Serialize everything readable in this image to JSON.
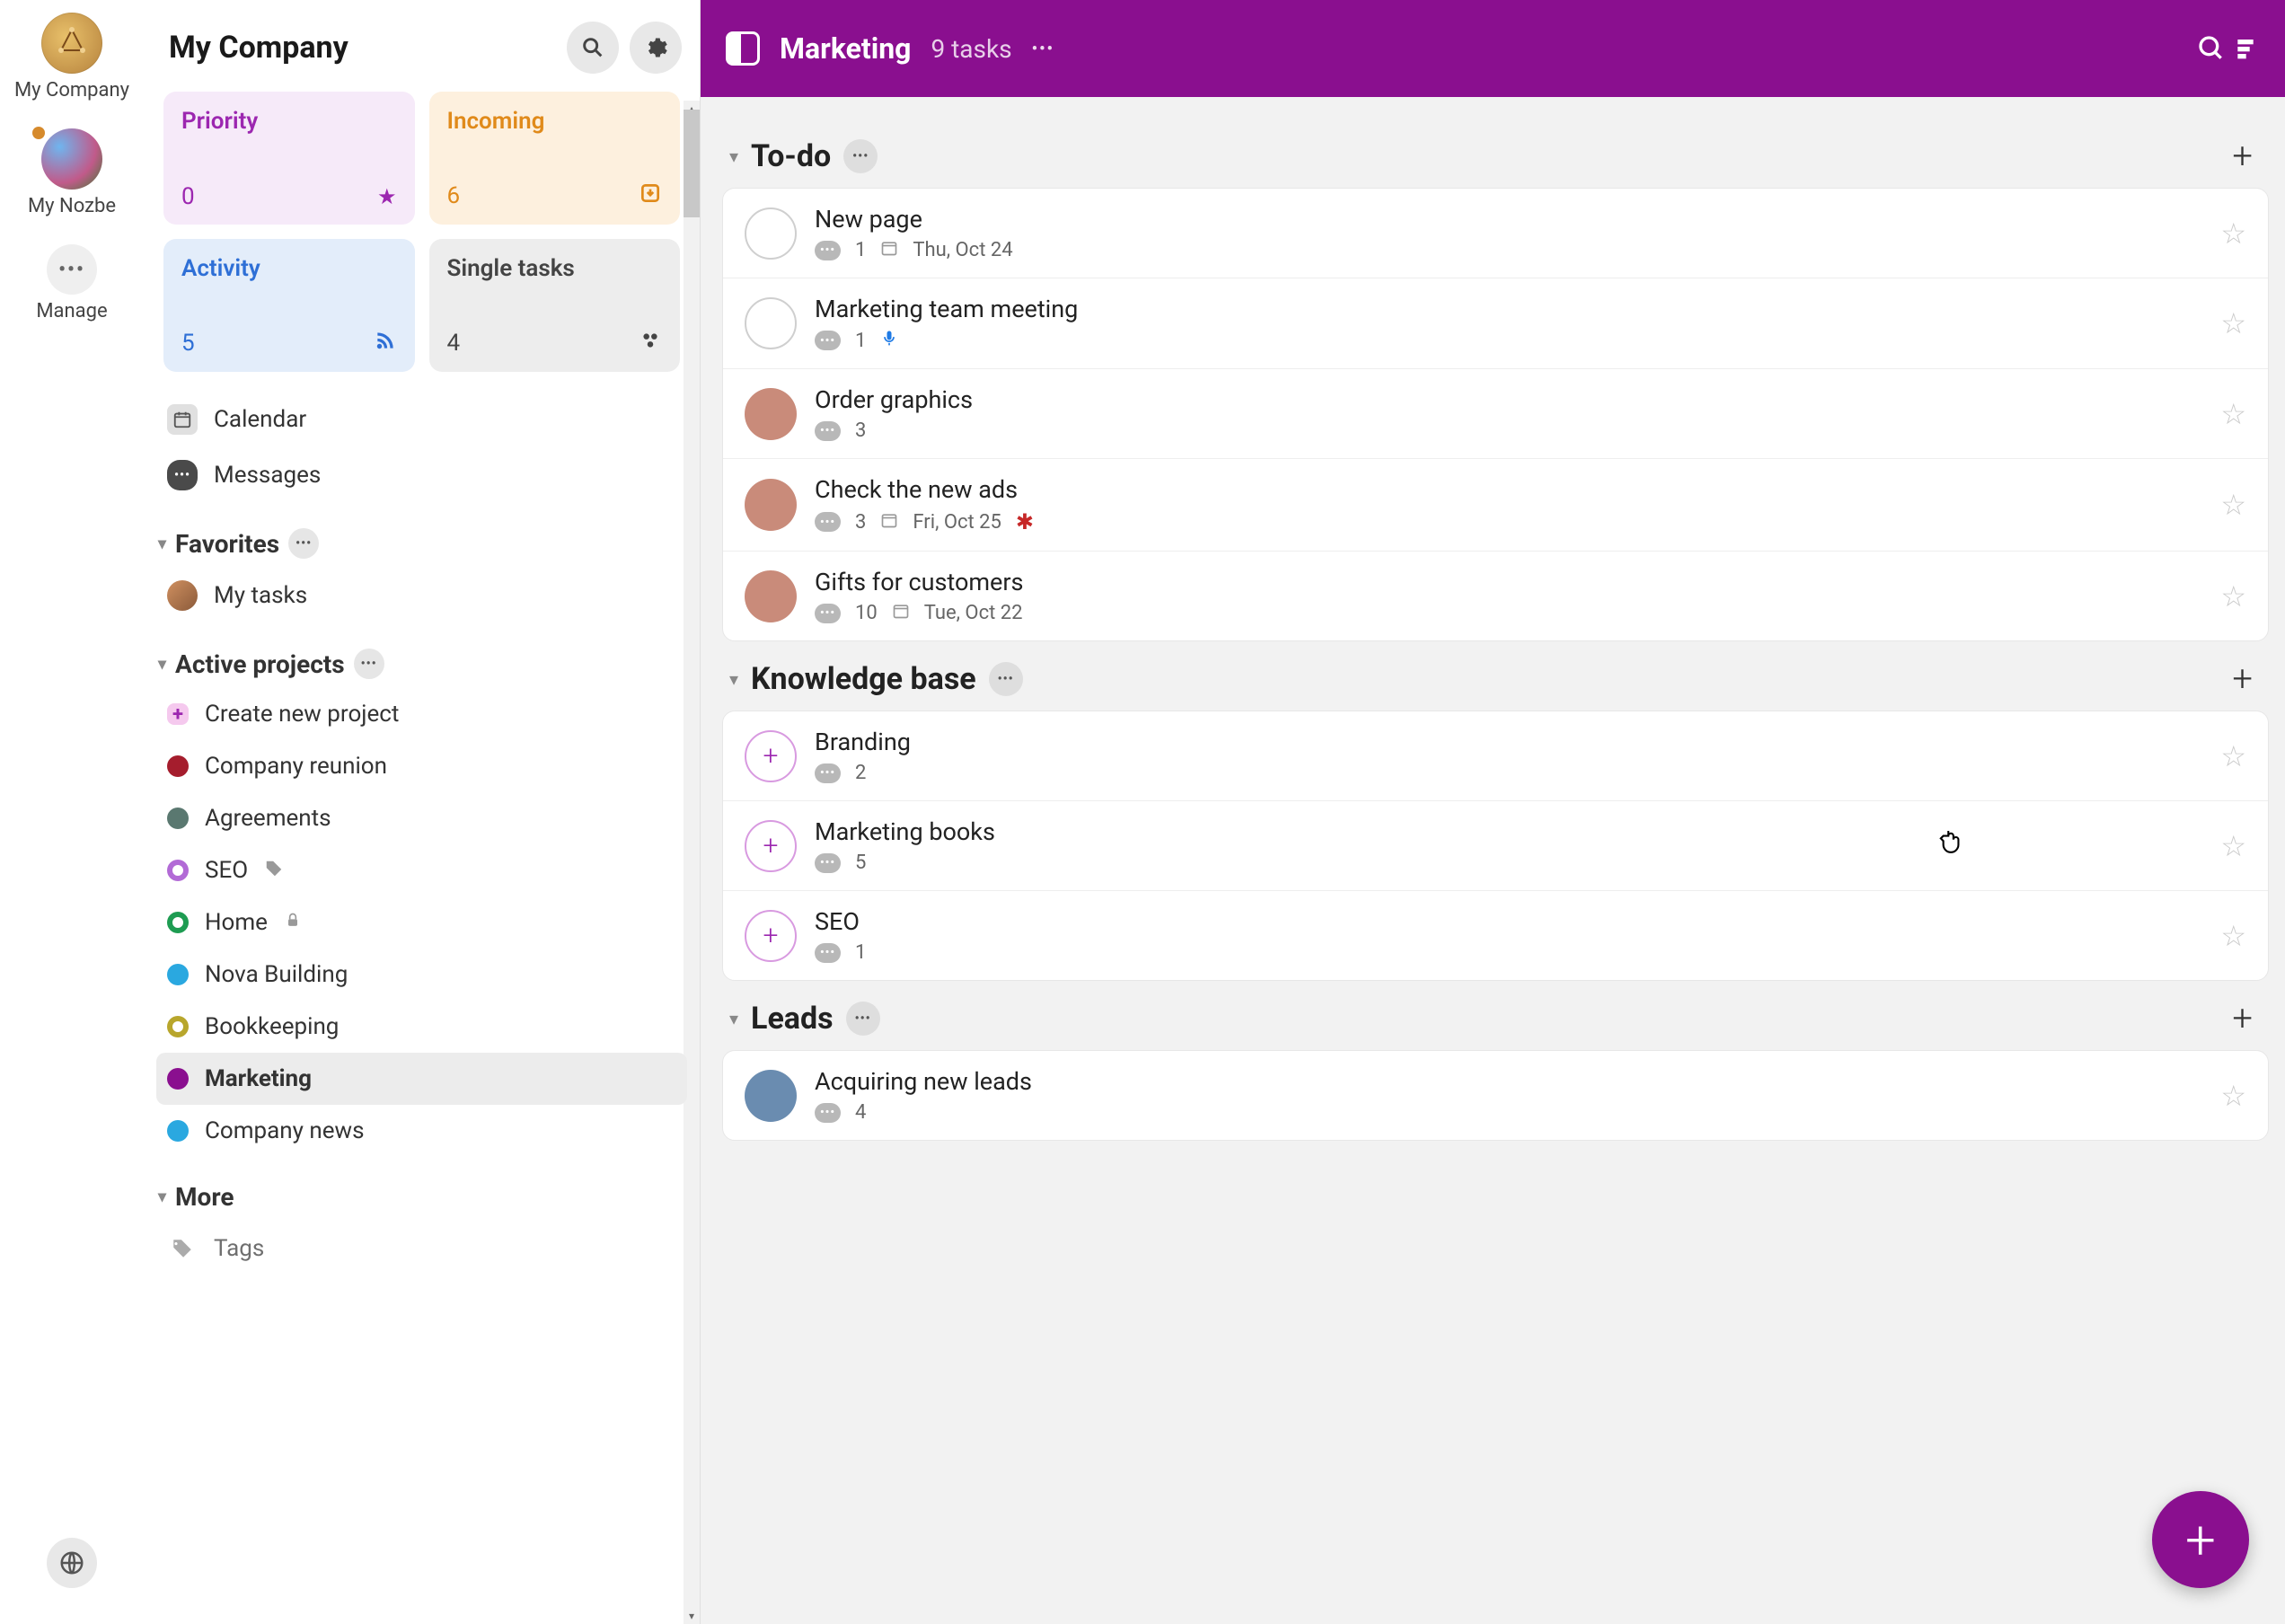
{
  "workspaces": [
    {
      "label": "My Company",
      "avatarClass": "company",
      "hasDot": false
    },
    {
      "label": "My Nozbe",
      "avatarClass": "nozbe",
      "hasDot": true
    },
    {
      "label": "Manage",
      "avatarClass": "manage",
      "hasDot": false,
      "glyph": "•••"
    }
  ],
  "sidebar": {
    "title": "My Company",
    "cards": {
      "priority": {
        "title": "Priority",
        "count": "0"
      },
      "incoming": {
        "title": "Incoming",
        "count": "6"
      },
      "activity": {
        "title": "Activity",
        "count": "5"
      },
      "single": {
        "title": "Single tasks",
        "count": "4"
      }
    },
    "nav": {
      "calendar": "Calendar",
      "messages": "Messages"
    },
    "favorites": {
      "title": "Favorites",
      "items": [
        {
          "label": "My tasks"
        }
      ]
    },
    "activeProjects": {
      "title": "Active projects",
      "createLabel": "Create new project",
      "items": [
        {
          "label": "Company reunion",
          "color": "#a51d2d",
          "style": "solid"
        },
        {
          "label": "Agreements",
          "color": "#5a7870",
          "style": "solid"
        },
        {
          "label": "SEO",
          "color": "#b26ad6",
          "style": "ring",
          "badge": "tag"
        },
        {
          "label": "Home",
          "color": "#1e9c52",
          "style": "ring",
          "badge": "lock"
        },
        {
          "label": "Nova Building",
          "color": "#2aa8e0",
          "style": "solid"
        },
        {
          "label": "Bookkeeping",
          "color": "#b8a62c",
          "style": "ring"
        },
        {
          "label": "Marketing",
          "color": "#8a0f8f",
          "style": "solid",
          "active": true
        },
        {
          "label": "Company news",
          "color": "#2aa8e0",
          "style": "solid"
        }
      ]
    },
    "more": {
      "title": "More",
      "tags": "Tags"
    }
  },
  "topbar": {
    "title": "Marketing",
    "tasksLabel": "9 tasks"
  },
  "groups": [
    {
      "title": "To-do",
      "tasks": [
        {
          "title": "New page",
          "check": "empty",
          "comments": "1",
          "date": "Thu, Oct 24"
        },
        {
          "title": "Marketing team meeting",
          "check": "empty",
          "comments": "1",
          "mic": true
        },
        {
          "title": "Order graphics",
          "check": "avatar",
          "avatarColor": "#c98b7a",
          "comments": "3"
        },
        {
          "title": "Check the new ads",
          "check": "avatar",
          "avatarColor": "#c98b7a",
          "comments": "3",
          "date": "Fri, Oct 25",
          "flag": true
        },
        {
          "title": "Gifts for customers",
          "check": "avatar",
          "avatarColor": "#c98b7a",
          "comments": "10",
          "date": "Tue, Oct 22"
        }
      ]
    },
    {
      "title": "Knowledge base",
      "tasks": [
        {
          "title": "Branding",
          "check": "plus",
          "comments": "2"
        },
        {
          "title": "Marketing books",
          "check": "plus",
          "comments": "5"
        },
        {
          "title": "SEO",
          "check": "plus",
          "comments": "1"
        }
      ]
    },
    {
      "title": "Leads",
      "tasks": [
        {
          "title": "Acquiring new leads",
          "check": "avatar",
          "avatarColor": "#6a8cb0",
          "comments": "4"
        }
      ]
    }
  ]
}
